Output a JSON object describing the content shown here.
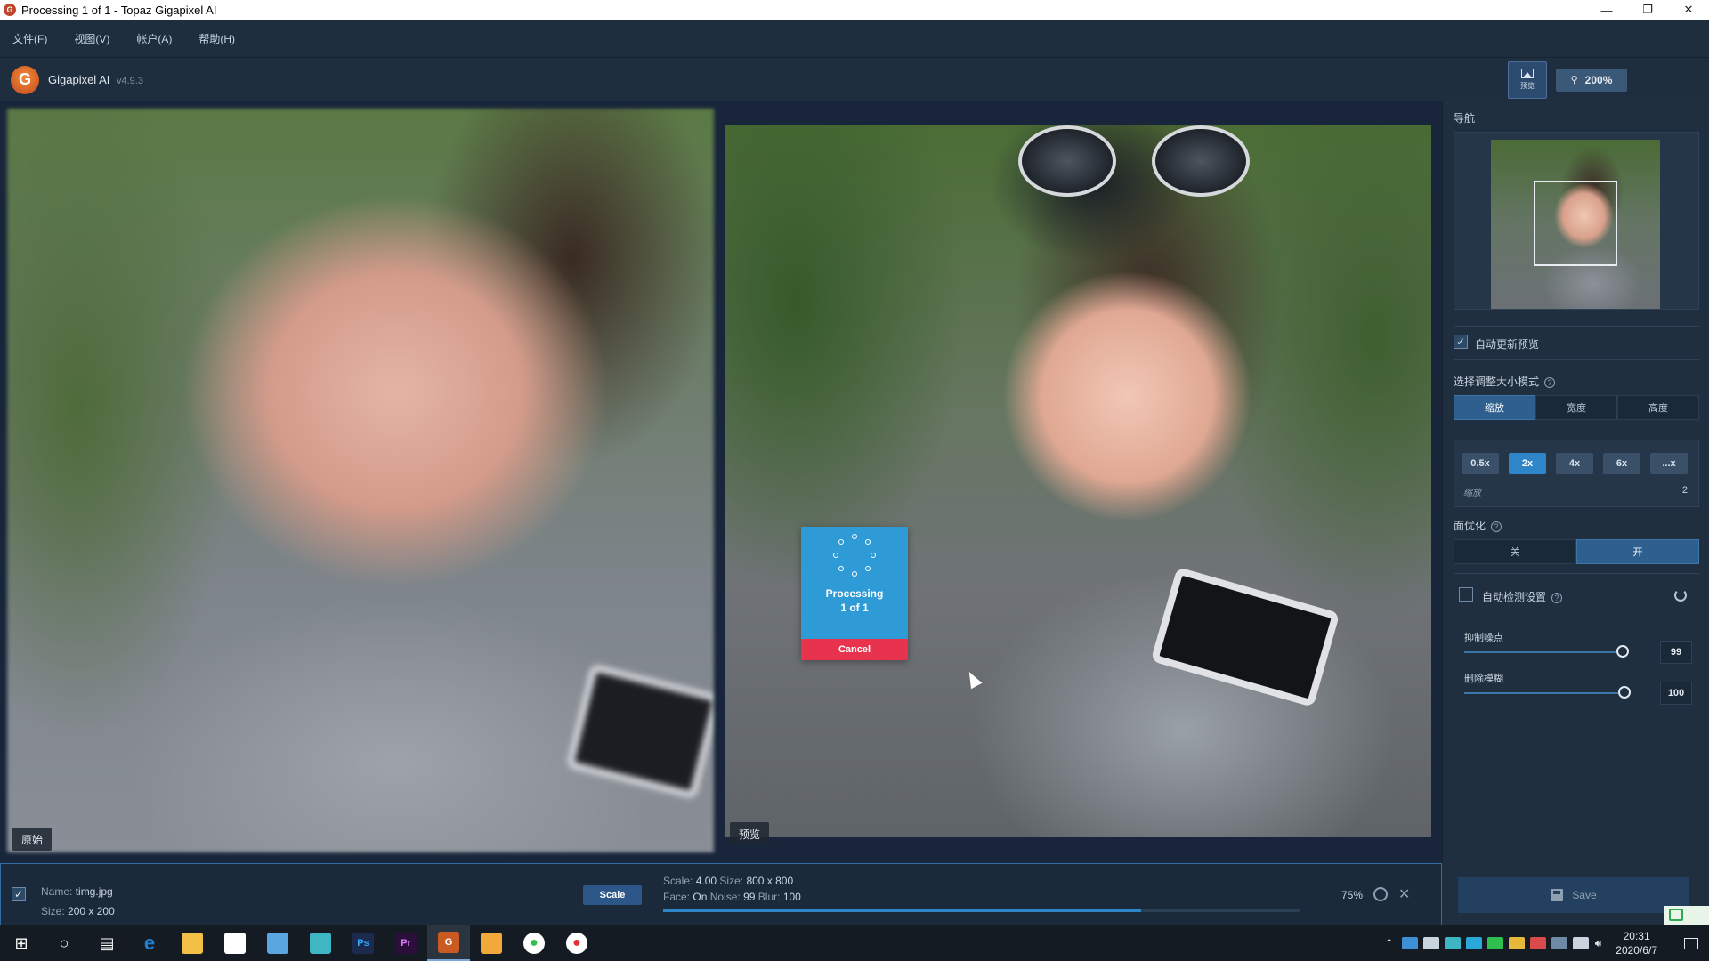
{
  "window": {
    "title": "Processing 1 of 1 - Topaz Gigapixel AI",
    "icon": "gigapixel-app-icon",
    "controls": [
      "minimize",
      "restore",
      "close"
    ]
  },
  "menu": [
    {
      "label": "文件(F)"
    },
    {
      "label": "视图(V)"
    },
    {
      "label": "帐户(A)"
    },
    {
      "label": "帮助(H)"
    }
  ],
  "toolbar": {
    "app_name": "Gigapixel AI",
    "version": "v4.9.3",
    "preview_button_label": "预览",
    "zoom_label": "200%"
  },
  "canvas": {
    "left_tag": "原始",
    "right_tag": "预览"
  },
  "processing": {
    "line1": "Processing",
    "line2": "1 of 1",
    "cancel_label": "Cancel"
  },
  "sidebar": {
    "nav_title": "导航",
    "auto_update_label": "自动更新预览",
    "auto_update_checked": true,
    "resize_mode_title": "选择调整大小模式",
    "resize_modes": [
      "缩放",
      "宽度",
      "高度"
    ],
    "resize_mode_selected": "缩放",
    "scale_buttons": [
      "0.5x",
      "2x",
      "4x",
      "6x",
      "...x"
    ],
    "scale_selected": "2x",
    "scale_label": "缩放",
    "scale_value": "2",
    "face_title": "面优化",
    "face_options": [
      "关",
      "开"
    ],
    "face_selected": "开",
    "auto_detect_label": "自动检测设置",
    "auto_detect_checked": false,
    "sliders": [
      {
        "label": "抑制噪点",
        "value": "99",
        "level": 0.99
      },
      {
        "label": "删除模糊",
        "value": "100",
        "level": 1.0
      }
    ]
  },
  "filebar": {
    "checked": true,
    "name_label": "Name:",
    "name_value": "timg.jpg",
    "size_label": "Size:",
    "size_value": "200 x 200",
    "scale_button": "Scale",
    "scale_label": "Scale:",
    "scale_value": "4.00",
    "out_size_label": "Size:",
    "out_size_value": "800 x 800",
    "face_label": "Face:",
    "face_value": "On",
    "noise_label": "Noise:",
    "noise_value": "99",
    "blur_label": "Blur:",
    "blur_value": "100",
    "progress_percent": "75%",
    "progress_fraction": 0.75
  },
  "save": {
    "label": "Save"
  },
  "taskbar": {
    "apps": [
      {
        "name": "windows-start",
        "glyph": "⊞",
        "color": "#ffffff"
      },
      {
        "name": "cortana-search",
        "glyph": "○",
        "color": "#ffffff"
      },
      {
        "name": "task-view",
        "glyph": "▤",
        "color": "#ffffff"
      },
      {
        "name": "edge-browser",
        "glyph": "e",
        "color": "#1e7fd6"
      },
      {
        "name": "file-explorer",
        "glyph": "",
        "color": "#f2c046"
      },
      {
        "name": "microsoft-store",
        "glyph": "",
        "color": "#ffffff"
      },
      {
        "name": "app-gallery",
        "glyph": "",
        "color": "#5aa6e0"
      },
      {
        "name": "cloud-app",
        "glyph": "",
        "color": "#3fb6c4"
      },
      {
        "name": "photoshop",
        "glyph": "Ps",
        "color": "#1b2a4d"
      },
      {
        "name": "premiere-pro",
        "glyph": "Pr",
        "color": "#2a0f3a"
      },
      {
        "name": "gigapixel",
        "glyph": "G",
        "color": "#c85a22"
      },
      {
        "name": "paint-app",
        "glyph": "",
        "color": "#f0a93a"
      },
      {
        "name": "green-record",
        "glyph": "●",
        "color": "#2fbf4f"
      },
      {
        "name": "red-record",
        "glyph": "●",
        "color": "#e23232"
      }
    ],
    "time": "20:31",
    "date": "2020/6/7"
  }
}
